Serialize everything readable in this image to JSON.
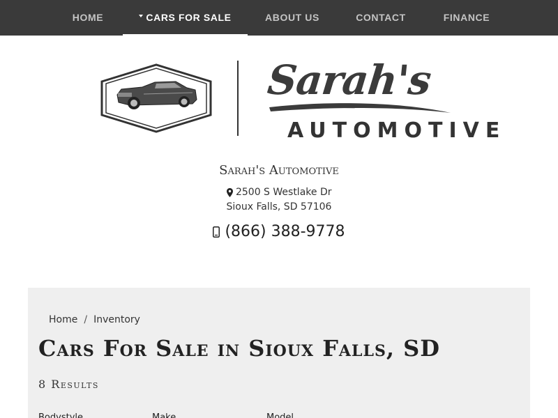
{
  "nav": {
    "items": [
      {
        "label": "HOME"
      },
      {
        "label": "CARS FOR SALE"
      },
      {
        "label": "ABOUT US"
      },
      {
        "label": "CONTACT"
      },
      {
        "label": "FINANCE"
      }
    ],
    "active": "CARS FOR SALE"
  },
  "logo": {
    "script_text": "Sarah's",
    "sub_text": "AUTOMOTIVE"
  },
  "dealer": {
    "name": "Sarah's Automotive",
    "address_line1": "2500 S Westlake Dr",
    "address_line2": "Sioux Falls, SD 57106",
    "phone": "(866) 388-9778"
  },
  "breadcrumb": {
    "home": "Home",
    "separator": "/",
    "current": "Inventory"
  },
  "page": {
    "title": "Cars For Sale in Sioux Falls, SD",
    "results": "8 Results"
  },
  "filters": {
    "labels": [
      "Bodystyle",
      "Make",
      "Model"
    ]
  },
  "colors": {
    "navbar_bg": "#3a3a3a",
    "nav_text": "#c4c4c4",
    "nav_active_text": "#ffffff",
    "panel_bg": "#efefef",
    "text_dark": "#222222"
  },
  "icons": {
    "address": "map-marker-icon",
    "phone": "mobile-phone-icon"
  }
}
